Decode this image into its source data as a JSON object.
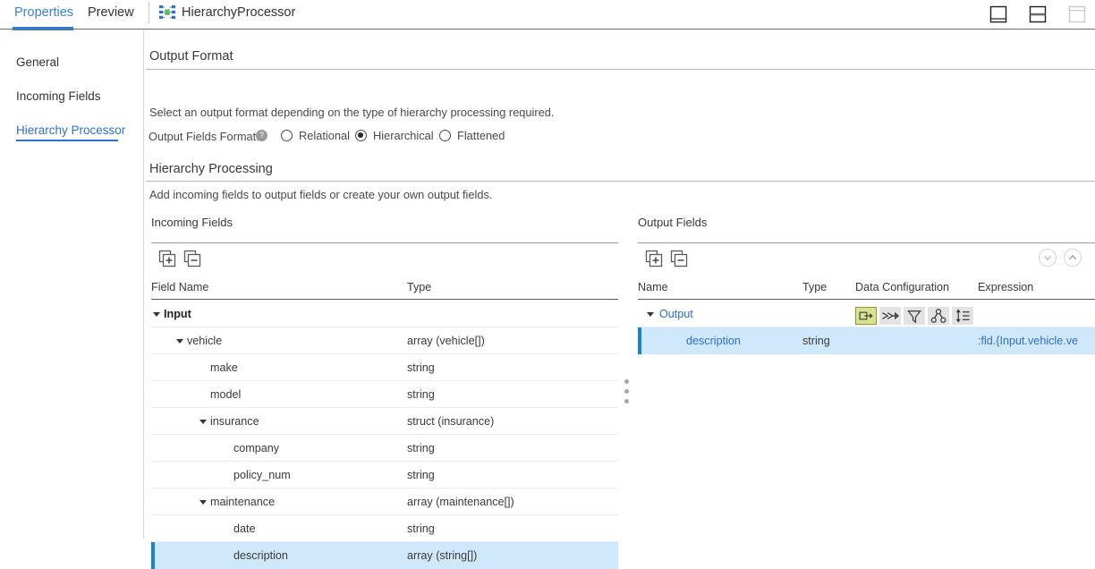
{
  "topbar": {
    "tabs": [
      {
        "label": "Properties",
        "active": true
      },
      {
        "label": "Preview",
        "active": false
      }
    ],
    "node_icon": "hierarchy-node-icon",
    "node_title": "HierarchyProcessor",
    "window_buttons": [
      {
        "name": "layout-bottom-panel-icon"
      },
      {
        "name": "layout-split-horizontal-icon"
      },
      {
        "name": "layout-maximize-icon"
      }
    ],
    "accent_color": "#2f7ad6"
  },
  "sidebar": {
    "items": [
      {
        "label": "General",
        "selected": false
      },
      {
        "label": "Incoming Fields",
        "selected": false
      },
      {
        "label": "Hierarchy Processor",
        "selected": true
      }
    ]
  },
  "output_format": {
    "title": "Output Format",
    "description": "Select an output format depending on the type of hierarchy processing required.",
    "field_label": "Output Fields Format:",
    "required_marker": "*",
    "help_icon": "help-question-icon",
    "help_glyph": "?",
    "options": [
      {
        "label": "Relational",
        "selected": false
      },
      {
        "label": "Hierarchical",
        "selected": true
      },
      {
        "label": "Flattened",
        "selected": false
      }
    ]
  },
  "hierarchy_processing": {
    "title": "Hierarchy Processing",
    "description": "Add incoming fields to output fields or create your own output fields."
  },
  "incoming_fields": {
    "title": "Incoming Fields",
    "toolbar": [
      {
        "name": "expand-all-icon",
        "glyph": "+"
      },
      {
        "name": "collapse-all-icon",
        "glyph": "−"
      }
    ],
    "columns": [
      "Field Name",
      "Type"
    ],
    "rows": [
      {
        "name": "Input",
        "type": "",
        "depth": 0,
        "expandable": true,
        "selected": false,
        "bold": true
      },
      {
        "name": "vehicle",
        "type": "array (vehicle[])",
        "depth": 1,
        "expandable": true,
        "selected": false,
        "bold": false
      },
      {
        "name": "make",
        "type": "string",
        "depth": 2,
        "expandable": false,
        "selected": false,
        "bold": false
      },
      {
        "name": "model",
        "type": "string",
        "depth": 2,
        "expandable": false,
        "selected": false,
        "bold": false
      },
      {
        "name": "insurance",
        "type": "struct (insurance)",
        "depth": 2,
        "expandable": true,
        "selected": false,
        "bold": false
      },
      {
        "name": "company",
        "type": "string",
        "depth": 3,
        "expandable": false,
        "selected": false,
        "bold": false
      },
      {
        "name": "policy_num",
        "type": "string",
        "depth": 3,
        "expandable": false,
        "selected": false,
        "bold": false
      },
      {
        "name": "maintenance",
        "type": "array (maintenance[])",
        "depth": 2,
        "expandable": true,
        "selected": false,
        "bold": false
      },
      {
        "name": "date",
        "type": "string",
        "depth": 3,
        "expandable": false,
        "selected": false,
        "bold": false
      },
      {
        "name": "description",
        "type": "array (string[])",
        "depth": 3,
        "expandable": false,
        "selected": true,
        "bold": false
      }
    ]
  },
  "output_fields": {
    "title": "Output Fields",
    "toolbar": [
      {
        "name": "add-output-field-icon",
        "glyph": "+"
      },
      {
        "name": "remove-output-field-icon",
        "glyph": "−"
      }
    ],
    "nav_buttons": [
      {
        "name": "move-down-icon"
      },
      {
        "name": "move-up-icon"
      }
    ],
    "columns": [
      "Name",
      "Type",
      "Data Configuration",
      "Expression"
    ],
    "data_config_icons": [
      {
        "name": "output-node-icon",
        "active": true
      },
      {
        "name": "split-arrays-icon",
        "active": false
      },
      {
        "name": "filter-funnel-icon",
        "active": false
      },
      {
        "name": "group-by-icon",
        "active": false
      },
      {
        "name": "sort-icon",
        "active": false
      }
    ],
    "data_config_active_color": "#d9e38f",
    "rows": [
      {
        "name": "Output",
        "type": "",
        "expression": "",
        "depth": 0,
        "expandable": true,
        "selected": false,
        "has_data_config": true,
        "link": true
      },
      {
        "name": "description",
        "type": "string",
        "expression": ":fld.{Input.vehicle.ve",
        "depth": 1,
        "expandable": false,
        "selected": true,
        "has_data_config": false,
        "link": true
      }
    ]
  },
  "splitter": {
    "name": "pane-resize-handle"
  }
}
